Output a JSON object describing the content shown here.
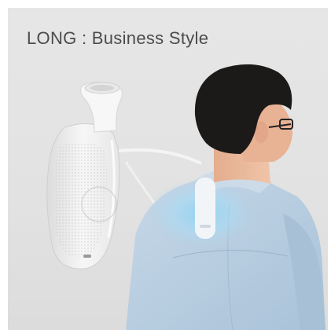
{
  "caption": {
    "text": "LONG : Business Style"
  },
  "scene": {
    "product": "neck-worn wearable cooling device (long attachment)",
    "subject": "man in light blue shirt wearing device, back view",
    "colors": {
      "background": "#e4e4e4",
      "caption_text": "#4b4b4b",
      "device_body": "#f4f4f4",
      "shirt": "#b8cfe2",
      "cool_glow": "#8fd3f2",
      "hair": "#1c1a19",
      "skin": "#e9b89b"
    }
  }
}
